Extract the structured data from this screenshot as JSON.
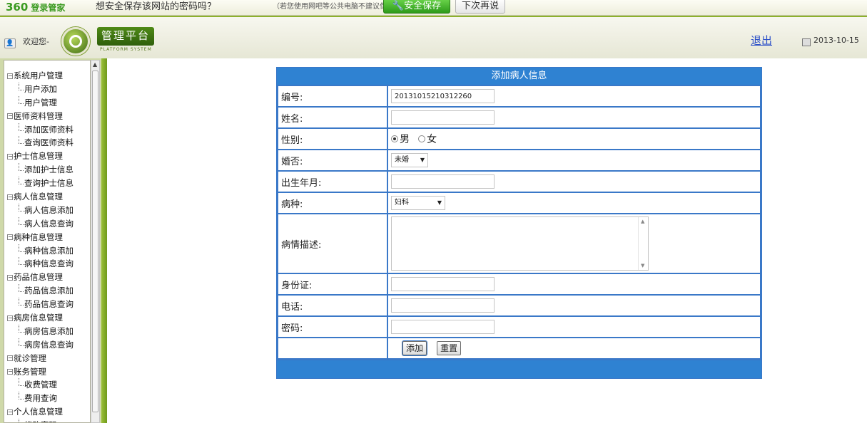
{
  "notice_bar": {
    "brand": "360",
    "brand_sub": "登录管家",
    "question": "想安全保存该网站的密码吗？",
    "hint": "（若您使用网吧等公共电脑不建议保存）",
    "save_button": "安全保存",
    "later_button": "下次再说"
  },
  "header": {
    "welcome": "欢迎您-",
    "platform_title": "管理平台",
    "platform_subtitle": "PLATFORM SYSTEM",
    "logout": "退出",
    "date": "2013-10-15",
    "accent_color": "#8db12c"
  },
  "sidebar": {
    "items": [
      {
        "type": "group",
        "label": "系统用户管理"
      },
      {
        "type": "child",
        "label": "用户添加"
      },
      {
        "type": "child",
        "label": "用户管理"
      },
      {
        "type": "group",
        "label": "医师资料管理"
      },
      {
        "type": "child",
        "label": "添加医师资料"
      },
      {
        "type": "child",
        "label": "查询医师资料"
      },
      {
        "type": "group",
        "label": "护士信息管理"
      },
      {
        "type": "child",
        "label": "添加护士信息"
      },
      {
        "type": "child",
        "label": "查询护士信息"
      },
      {
        "type": "group",
        "label": "病人信息管理"
      },
      {
        "type": "child",
        "label": "病人信息添加"
      },
      {
        "type": "child",
        "label": "病人信息查询"
      },
      {
        "type": "group",
        "label": "病种信息管理"
      },
      {
        "type": "child",
        "label": "病种信息添加"
      },
      {
        "type": "child",
        "label": "病种信息查询"
      },
      {
        "type": "group",
        "label": "药品信息管理"
      },
      {
        "type": "child",
        "label": "药品信息添加"
      },
      {
        "type": "child",
        "label": "药品信息查询"
      },
      {
        "type": "group",
        "label": "病房信息管理"
      },
      {
        "type": "child",
        "label": "病房信息添加"
      },
      {
        "type": "child",
        "label": "病房信息查询"
      },
      {
        "type": "group",
        "label": "就诊管理"
      },
      {
        "type": "group",
        "label": "账务管理"
      },
      {
        "type": "child",
        "label": "收费管理"
      },
      {
        "type": "child",
        "label": "费用查询"
      },
      {
        "type": "group",
        "label": "个人信息管理"
      },
      {
        "type": "child",
        "label": "修改密码"
      }
    ]
  },
  "form": {
    "title": "添加病人信息",
    "id_label": "编号:",
    "id_value": "20131015210312260",
    "name_label": "姓名:",
    "name_value": "",
    "gender_label": "性别:",
    "gender_male": "男",
    "gender_female": "女",
    "gender_selected": "男",
    "marital_label": "婚否:",
    "marital_value": "未婚",
    "birth_label": "出生年月:",
    "birth_value": "",
    "disease_label": "病种:",
    "disease_value": "妇科",
    "description_label": "病情描述:",
    "description_value": "",
    "idcard_label": "身份证:",
    "idcard_value": "",
    "phone_label": "电话:",
    "phone_value": "",
    "password_label": "密码:",
    "password_value": "",
    "add_button": "添加",
    "reset_button": "重置",
    "header_color": "#2f82d2"
  }
}
